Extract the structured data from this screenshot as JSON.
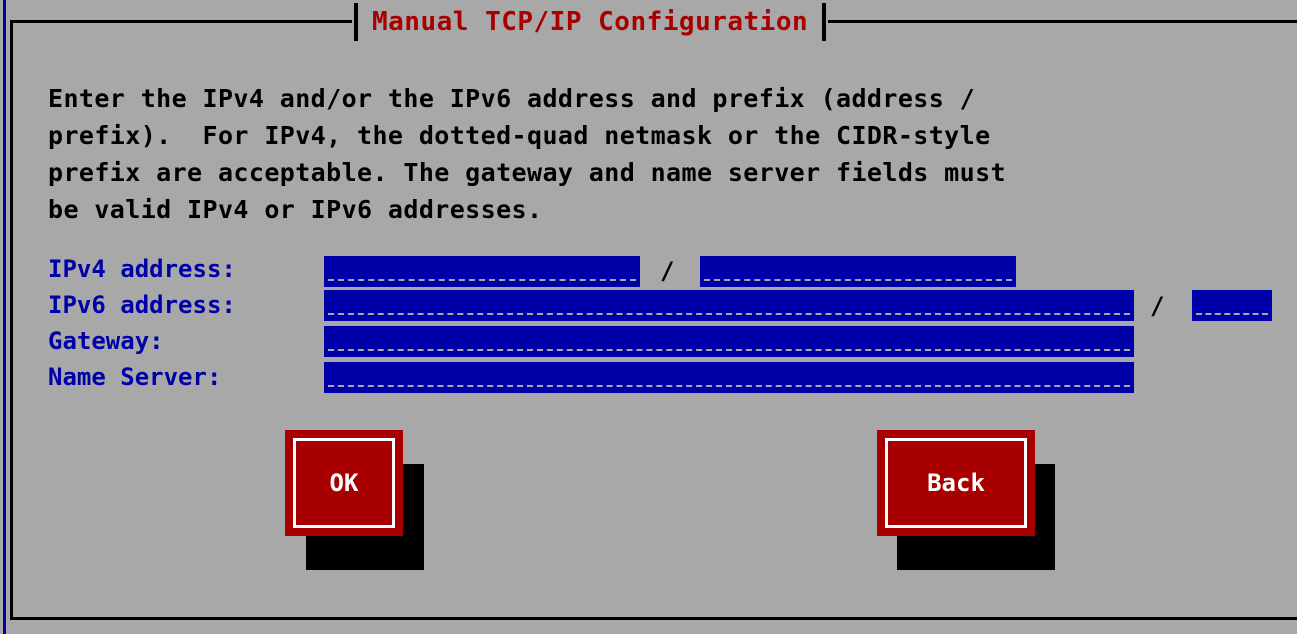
{
  "dialog": {
    "title": "Manual TCP/IP Configuration",
    "instructions": "Enter the IPv4 and/or the IPv6 address and prefix (address /\nprefix).  For IPv4, the dotted-quad netmask or the CIDR-style\nprefix are acceptable. The gateway and name server fields must\nbe valid IPv4 or IPv6 addresses."
  },
  "fields": {
    "ipv4_label": "IPv4 address:",
    "ipv4_address_value": "",
    "ipv4_prefix_value": "",
    "ipv6_label": "IPv6 address:",
    "ipv6_address_value": "",
    "ipv6_prefix_value": "",
    "gateway_label": "Gateway:",
    "gateway_value": "",
    "name_server_label": "Name Server:",
    "name_server_value": "",
    "separator": "/"
  },
  "buttons": {
    "ok": "OK",
    "back": "Back"
  },
  "colors": {
    "background": "#a8a8a8",
    "field": "#0000a8",
    "title": "#a80000",
    "button": "#a80000",
    "label": "#0000a8"
  }
}
